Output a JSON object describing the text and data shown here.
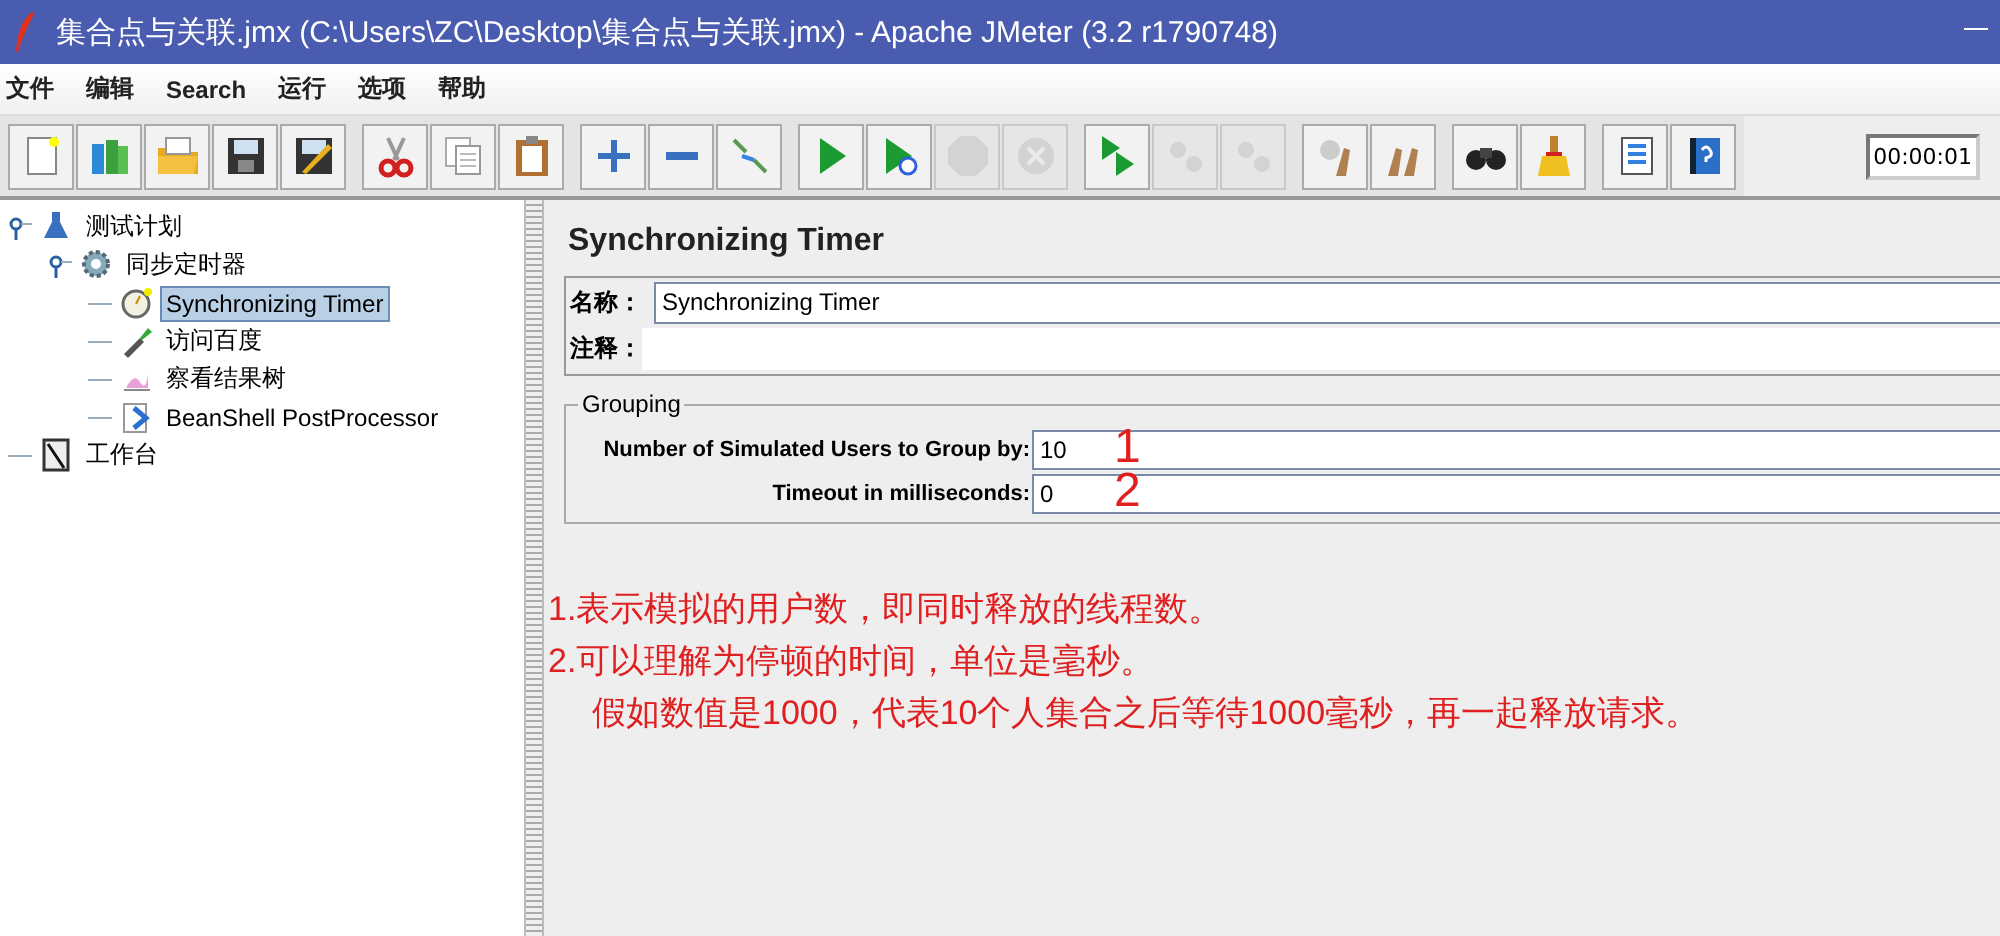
{
  "window": {
    "title": "集合点与关联.jmx (C:\\Users\\ZC\\Desktop\\集合点与关联.jmx) - Apache JMeter (3.2 r1790748)"
  },
  "menu": [
    "文件",
    "编辑",
    "Search",
    "运行",
    "选项",
    "帮助"
  ],
  "toolbar": {
    "groups": [
      [
        {
          "kind": "new",
          "disabled": false
        },
        {
          "kind": "templates",
          "disabled": false
        },
        {
          "kind": "open",
          "disabled": false
        },
        {
          "kind": "save",
          "disabled": false
        },
        {
          "kind": "save-as",
          "disabled": false
        }
      ],
      [
        {
          "kind": "cut",
          "disabled": false
        },
        {
          "kind": "copy",
          "disabled": false
        },
        {
          "kind": "paste",
          "disabled": false
        }
      ],
      [
        {
          "kind": "add",
          "disabled": false
        },
        {
          "kind": "remove",
          "disabled": false
        },
        {
          "kind": "toggle",
          "disabled": false
        }
      ],
      [
        {
          "kind": "start",
          "disabled": false
        },
        {
          "kind": "start-no-pause",
          "disabled": false
        },
        {
          "kind": "stop",
          "disabled": true
        },
        {
          "kind": "shutdown",
          "disabled": true
        }
      ],
      [
        {
          "kind": "remote-start",
          "disabled": false
        },
        {
          "kind": "remote-stop",
          "disabled": true
        },
        {
          "kind": "remote-shutdown",
          "disabled": true
        }
      ],
      [
        {
          "kind": "clear",
          "disabled": false
        },
        {
          "kind": "clear-all",
          "disabled": false
        }
      ],
      [
        {
          "kind": "search",
          "disabled": false
        },
        {
          "kind": "reset",
          "disabled": false
        }
      ],
      [
        {
          "kind": "functions",
          "disabled": false
        },
        {
          "kind": "help",
          "disabled": false
        }
      ]
    ],
    "timer": "00:00:01"
  },
  "tree": [
    {
      "label": "测试计划",
      "kind": "plan",
      "selected": false,
      "expanded": true,
      "children": [
        {
          "label": "同步定时器",
          "kind": "gear",
          "selected": false,
          "expanded": true,
          "children": [
            {
              "label": "Synchronizing Timer",
              "kind": "timer",
              "selected": true
            },
            {
              "label": "访问百度",
              "kind": "sampler",
              "selected": false
            },
            {
              "label": "察看结果树",
              "kind": "listener",
              "selected": false
            },
            {
              "label": "BeanShell PostProcessor",
              "kind": "post",
              "selected": false
            }
          ]
        }
      ]
    },
    {
      "label": "工作台",
      "kind": "workbench",
      "selected": false
    }
  ],
  "panel": {
    "title": "Synchronizing Timer",
    "name_label": "名称：",
    "name_value": "Synchronizing Timer",
    "comment_label": "注释：",
    "group_title": "Grouping",
    "fields": [
      {
        "label": "Number of Simulated Users to Group by:",
        "value": "10",
        "annotation": "1"
      },
      {
        "label": "Timeout in milliseconds:",
        "value": "0",
        "annotation": "2"
      }
    ]
  },
  "notes": [
    "1.表示模拟的用户数，即同时释放的线程数。",
    "2.可以理解为停顿的时间，单位是毫秒。",
    "假如数值是1000，代表10个人集合之后等待1000毫秒，再一起释放请求。"
  ]
}
